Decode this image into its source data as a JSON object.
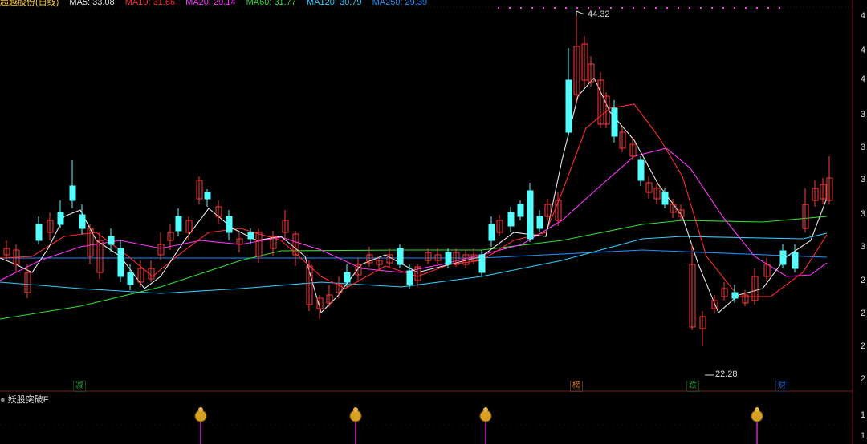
{
  "header": {
    "stock_name": "超越股份(日线)",
    "ma5": "MA5: 33.08",
    "ma10": "MA10: 31.66",
    "ma20": "MA20: 29.14",
    "ma60": "MA60: 31.77",
    "ma120": "MA120: 30.79",
    "ma250": "MA250: 29.39",
    "colors": {
      "ma5": "#e6e6e6",
      "ma10": "#ff2d2d",
      "ma20": "#ff33ff",
      "ma60": "#33dd33",
      "ma120": "#33ccff",
      "ma250": "#1e90ff"
    }
  },
  "chart": {
    "high_label": "44.32",
    "low_label": "22.28",
    "tags": [
      {
        "text": "减",
        "color": "#2ea043"
      },
      {
        "text": "榜",
        "color": "#d47a2a"
      },
      {
        "text": "跌",
        "color": "#2ea043"
      },
      {
        "text": "财",
        "color": "#2f6fd6"
      }
    ],
    "y_axis_labels": [
      "4",
      "4",
      "4",
      "3",
      "3",
      "3",
      "3",
      "3",
      "2",
      "2",
      "2",
      "2"
    ]
  },
  "indicator": {
    "title": "妖股突破F",
    "axis_labels": [
      "1",
      "1"
    ]
  }
}
